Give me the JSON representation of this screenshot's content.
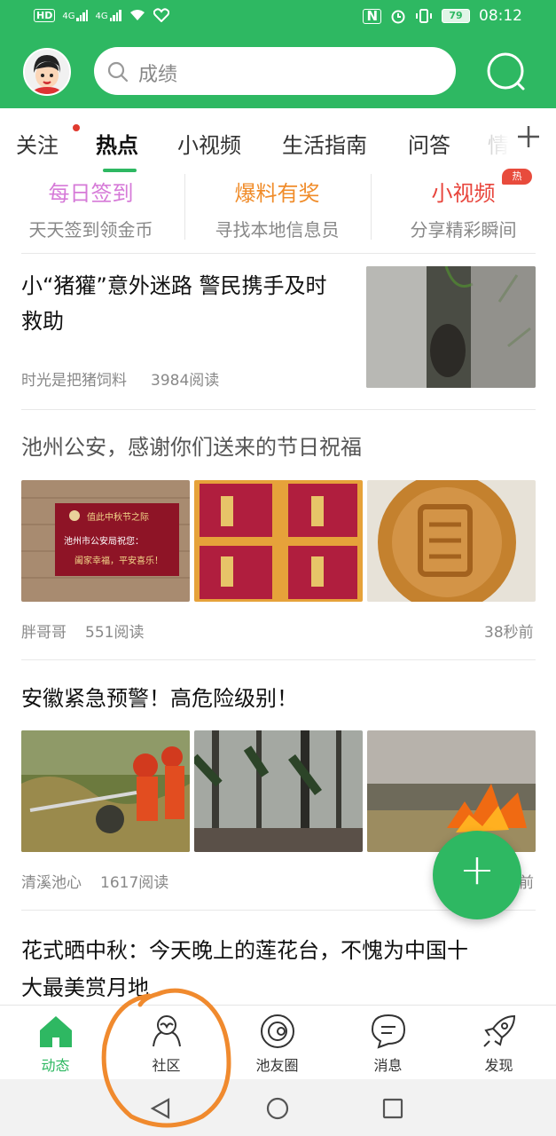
{
  "status_bar": {
    "left_chips": [
      "HD",
      "4G",
      "4G"
    ],
    "battery": "79",
    "time": "08:12"
  },
  "header": {
    "search_placeholder": "成绩"
  },
  "tabs": [
    "关注",
    "热点",
    "小视频",
    "生活指南",
    "问答",
    "情"
  ],
  "active_tab": "热点",
  "features": [
    {
      "title": "每日签到",
      "subtitle": "天天签到领金币",
      "color": "#d67ad8"
    },
    {
      "title": "爆料有奖",
      "subtitle": "寻找本地信息员",
      "color": "#f08c2a"
    },
    {
      "title": "小视频",
      "subtitle": "分享精彩瞬间",
      "color": "#e8453c",
      "badge": "热"
    }
  ],
  "articles": [
    {
      "title_line1": "小“猪獾”意外迷路 警民携手及时",
      "title_line2": "救助",
      "source": "时光是把猪饲料",
      "reads": "3984阅读"
    },
    {
      "title": "池州公安，感谢你们送来的节日祝福",
      "source": "胖哥哥",
      "reads": "551阅读",
      "time": "38秒前",
      "card_text": [
        "值此中秋节之际",
        "池州市公安局祝您：",
        "阖家幸福，平安喜乐！"
      ]
    },
    {
      "title": "安徽紧急预警！高危险级别！",
      "source": "清溪池心",
      "reads": "1617阅读",
      "time_partial": "前"
    },
    {
      "title_line1": "花式晒中秋：今天晚上的莲花台，不愧为中国十",
      "title_line2": "大最美赏月地"
    }
  ],
  "fab_label": "+",
  "bottom_nav": [
    {
      "label": "动态",
      "icon": "home-icon",
      "active": true
    },
    {
      "label": "社区",
      "icon": "community-icon",
      "active": false
    },
    {
      "label": "池友圈",
      "icon": "planet-icon",
      "active": false
    },
    {
      "label": "消息",
      "icon": "message-icon",
      "active": false
    },
    {
      "label": "发现",
      "icon": "rocket-icon",
      "active": false
    }
  ],
  "colors": {
    "brand": "#2eb862",
    "annotation": "#f08a2e"
  }
}
